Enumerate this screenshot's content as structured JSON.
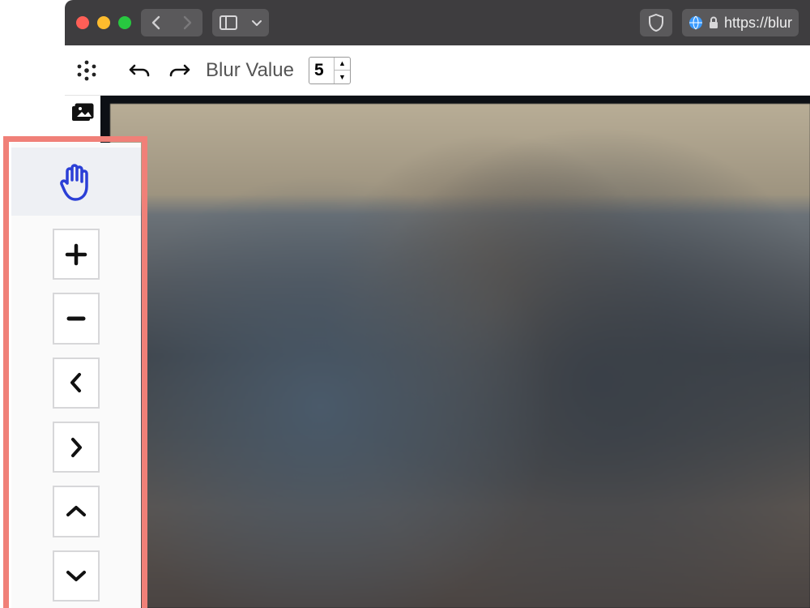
{
  "browser": {
    "url_display": "https://blur",
    "back_enabled": true,
    "forward_enabled": false
  },
  "toolbar": {
    "blur_label": "Blur Value",
    "blur_value": "5"
  },
  "palette": {
    "tools": [
      {
        "name": "hand-tool",
        "active": true
      },
      {
        "name": "zoom-in",
        "active": false
      },
      {
        "name": "zoom-out",
        "active": false
      },
      {
        "name": "pan-left",
        "active": false
      },
      {
        "name": "pan-right",
        "active": false
      },
      {
        "name": "pan-up",
        "active": false
      },
      {
        "name": "pan-down",
        "active": false
      }
    ]
  }
}
